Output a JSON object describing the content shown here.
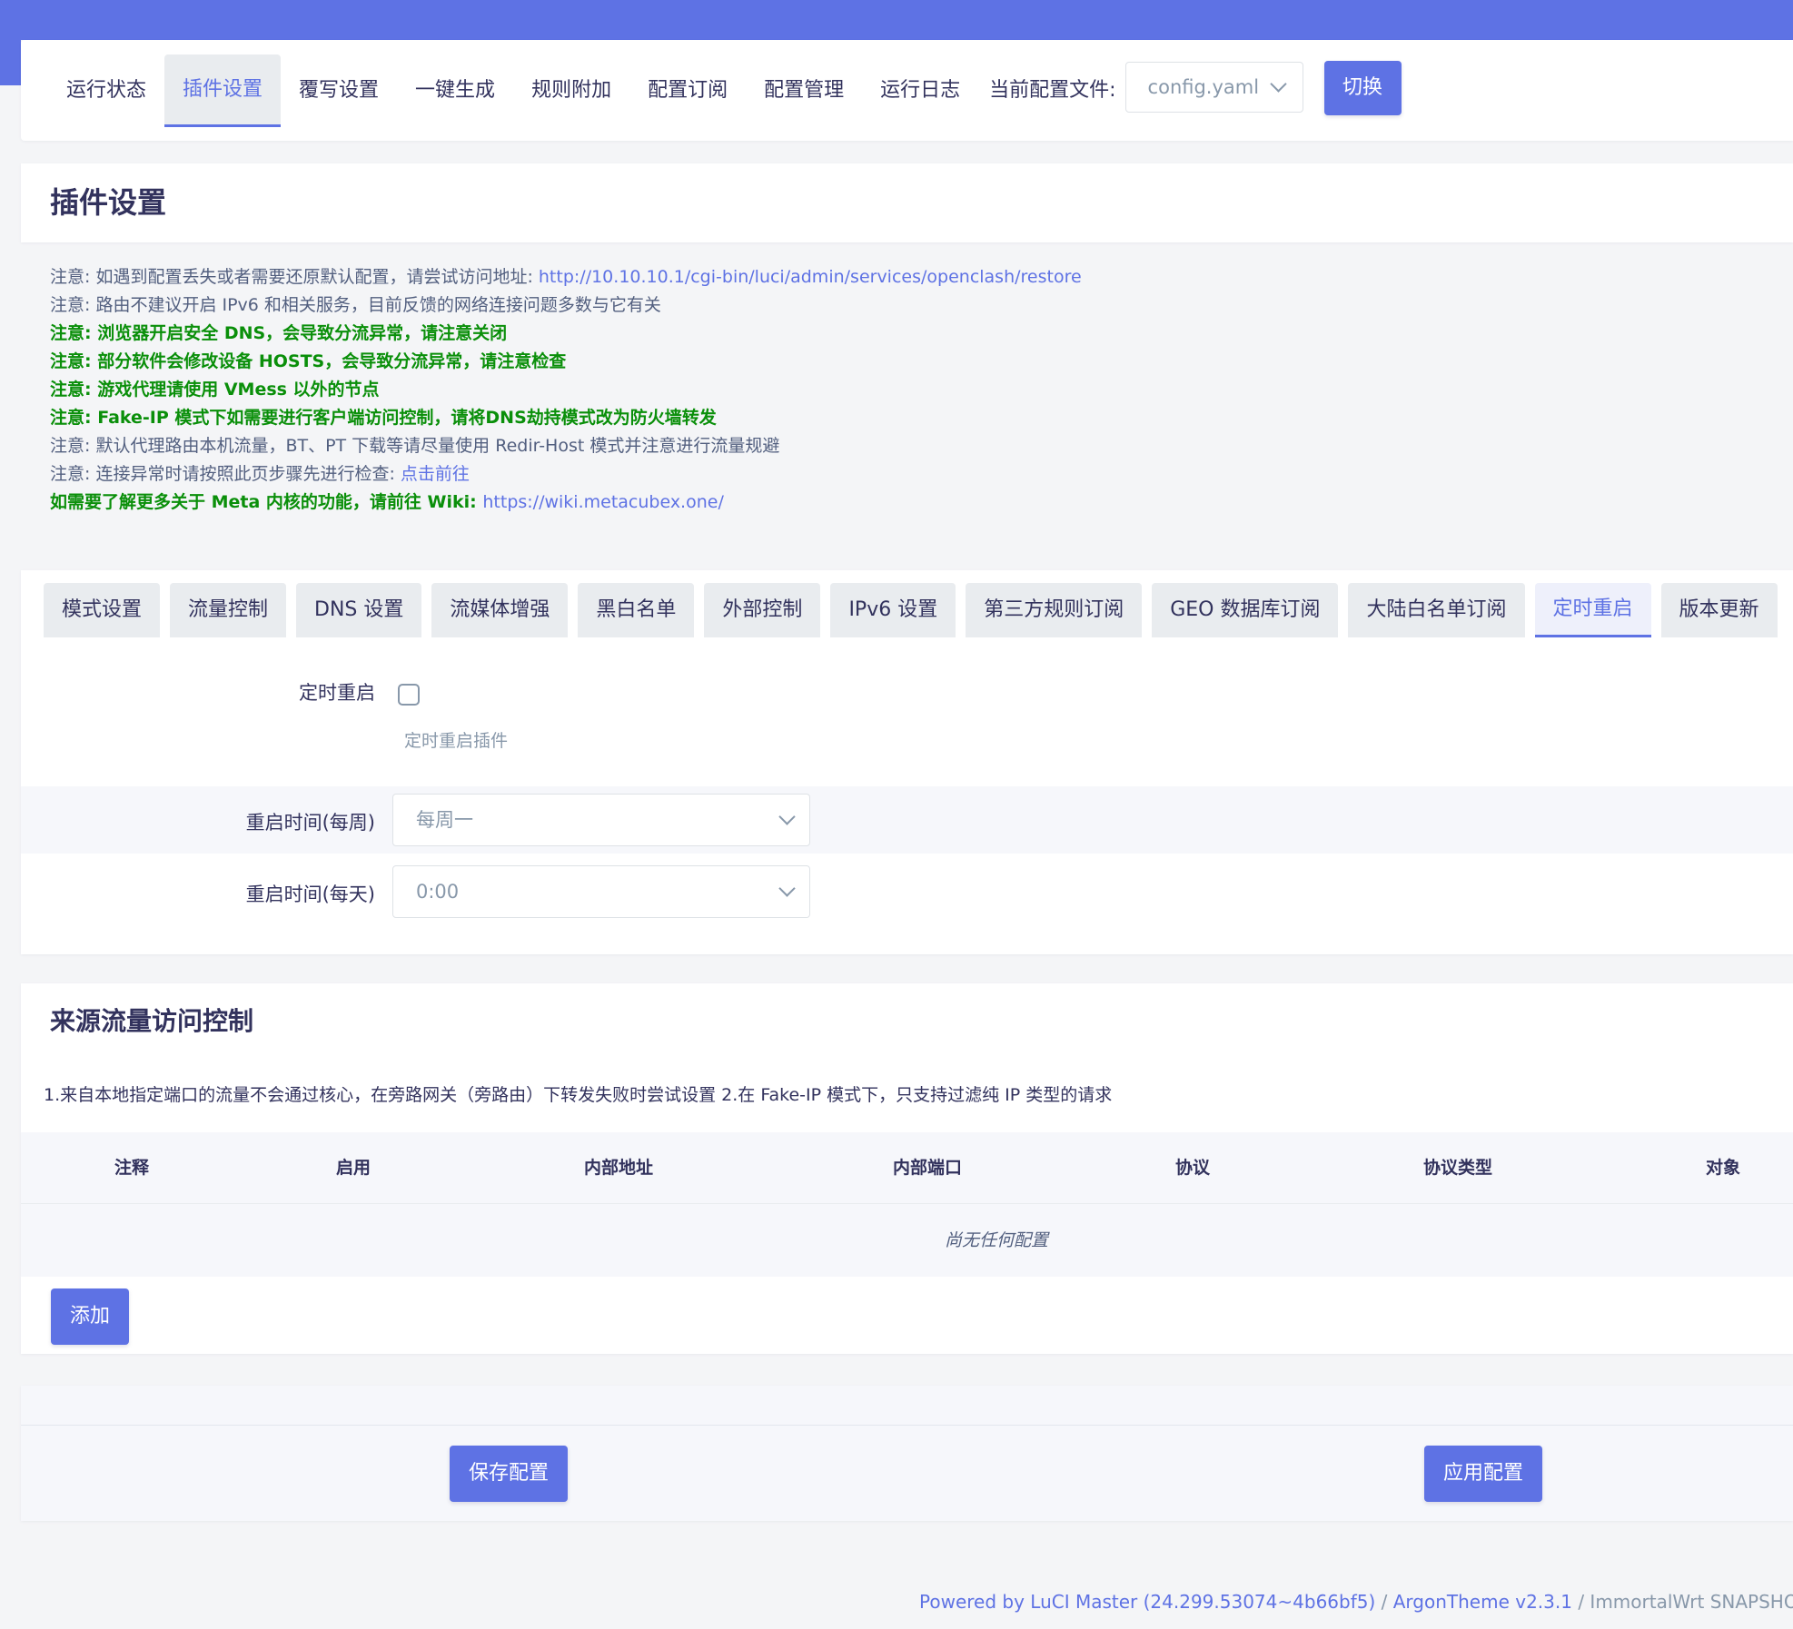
{
  "nav": {
    "tabs": [
      {
        "label": "运行状态",
        "active": false
      },
      {
        "label": "插件设置",
        "active": true
      },
      {
        "label": "覆写设置",
        "active": false
      },
      {
        "label": "一键生成",
        "active": false
      },
      {
        "label": "规则附加",
        "active": false
      },
      {
        "label": "配置订阅",
        "active": false
      },
      {
        "label": "配置管理",
        "active": false
      },
      {
        "label": "运行日志",
        "active": false
      }
    ],
    "config_label": "当前配置文件:",
    "config_value": "config.yaml",
    "switch_label": "切换"
  },
  "page": {
    "title": "插件设置"
  },
  "notes": [
    {
      "text": "注意: 如遇到配置丢失或者需要还原默认配置，请尝试访问地址: ",
      "link": "http://10.10.10.1/cgi-bin/luci/admin/services/openclash/restore",
      "style": "normal"
    },
    {
      "text": "注意: 路由不建议开启 IPv6 和相关服务，目前反馈的网络连接问题多数与它有关",
      "style": "normal"
    },
    {
      "text": "注意: 浏览器开启安全 DNS，会导致分流异常，请注意关闭",
      "style": "green"
    },
    {
      "text": "注意: 部分软件会修改设备 HOSTS，会导致分流异常，请注意检查",
      "style": "green"
    },
    {
      "text": "注意: 游戏代理请使用 VMess 以外的节点",
      "style": "green"
    },
    {
      "text": "注意: Fake-IP 模式下如需要进行客户端访问控制，请将DNS劫持模式改为防火墙转发",
      "style": "green"
    },
    {
      "text": "注意: 默认代理路由本机流量，BT、PT 下载等请尽量使用 Redir-Host 模式并注意进行流量规避",
      "style": "normal"
    },
    {
      "text": "注意: 连接异常时请按照此页步骤先进行检查: ",
      "link": "点击前往",
      "style": "normal"
    },
    {
      "text": "如需要了解更多关于 Meta 内核的功能，请前往 Wiki: ",
      "link": "https://wiki.metacubex.one/",
      "style": "green"
    }
  ],
  "settings_tabs": [
    {
      "label": "模式设置",
      "active": false
    },
    {
      "label": "流量控制",
      "active": false
    },
    {
      "label": "DNS 设置",
      "active": false
    },
    {
      "label": "流媒体增强",
      "active": false
    },
    {
      "label": "黑白名单",
      "active": false
    },
    {
      "label": "外部控制",
      "active": false
    },
    {
      "label": "IPv6 设置",
      "active": false
    },
    {
      "label": "第三方规则订阅",
      "active": false
    },
    {
      "label": "GEO 数据库订阅",
      "active": false
    },
    {
      "label": "大陆白名单订阅",
      "active": false
    },
    {
      "label": "定时重启",
      "active": true
    },
    {
      "label": "版本更新",
      "active": false
    }
  ],
  "restart": {
    "enable_label": "定时重启",
    "enable_checked": false,
    "enable_help": "定时重启插件",
    "weekly_label": "重启时间(每周)",
    "weekly_value": "每周一",
    "daily_label": "重启时间(每天)",
    "daily_value": "0:00"
  },
  "acl": {
    "title": "来源流量访问控制",
    "description": "1.来自本地指定端口的流量不会通过核心，在旁路网关（旁路由）下转发失败时尝试设置 2.在 Fake-IP 模式下，只支持过滤纯 IP 类型的请求",
    "columns": [
      "注释",
      "启用",
      "内部地址",
      "内部端口",
      "协议",
      "协议类型",
      "对象"
    ],
    "empty_text": "尚无任何配置",
    "add_label": "添加"
  },
  "actions": {
    "save_label": "保存配置",
    "apply_label": "应用配置"
  },
  "footer": {
    "powered": "Powered by LuCI Master (24.299.53074~4b66bf5)",
    "sep1": " / ",
    "theme": "ArgonTheme v2.3.1",
    "sep2": " / ",
    "build": "ImmortalWrt SNAPSHOT"
  },
  "colors": {
    "accent": "#5e72e4",
    "warning_green": "#0a8f0a",
    "text": "#32325d",
    "muted": "#8898aa"
  }
}
